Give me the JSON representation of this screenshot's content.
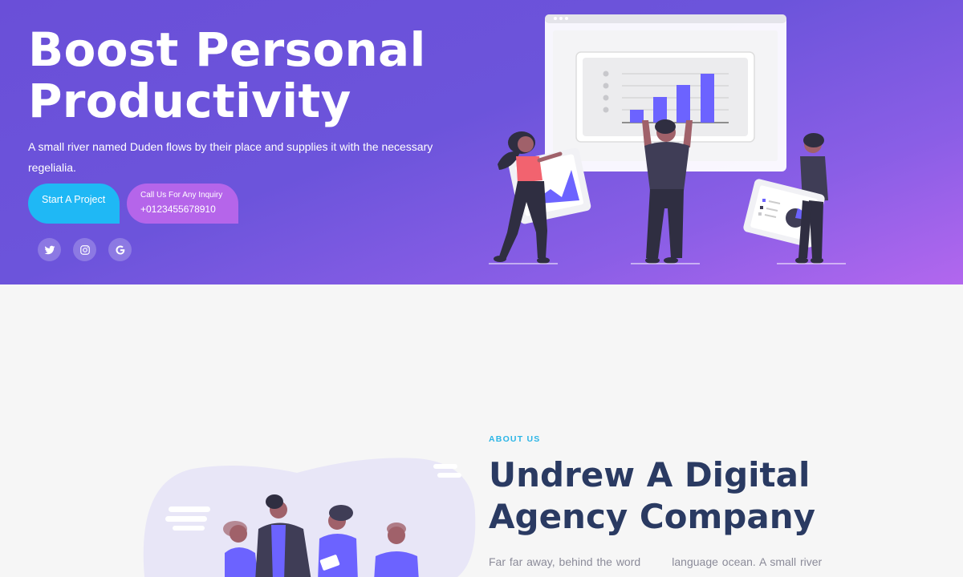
{
  "hero": {
    "title_line1": "Boost Personal",
    "title_line2": "Productivity",
    "description": "A small river named Duden flows by their place and supplies it with the necessary regelialia.",
    "primary_button": "Start A Project",
    "call_label": "Call Us For Any Inquiry",
    "call_phone": "+0123455678910",
    "socials": [
      "twitter-icon",
      "instagram-icon",
      "google-icon"
    ]
  },
  "about": {
    "tag": "ABOUT US",
    "title_line1": "Undrew A Digital",
    "title_line2": "Agency Company",
    "description": "Far far away, behind the word        language ocean. A small river"
  },
  "colors": {
    "hero_gradient_start": "#6a4fd8",
    "hero_gradient_end": "#b267ee",
    "primary_button": "#1fb8f5",
    "call_button": "#b565ea",
    "accent": "#6c63ff",
    "heading_dark": "#2a3a62",
    "tag": "#2bb5e6"
  }
}
